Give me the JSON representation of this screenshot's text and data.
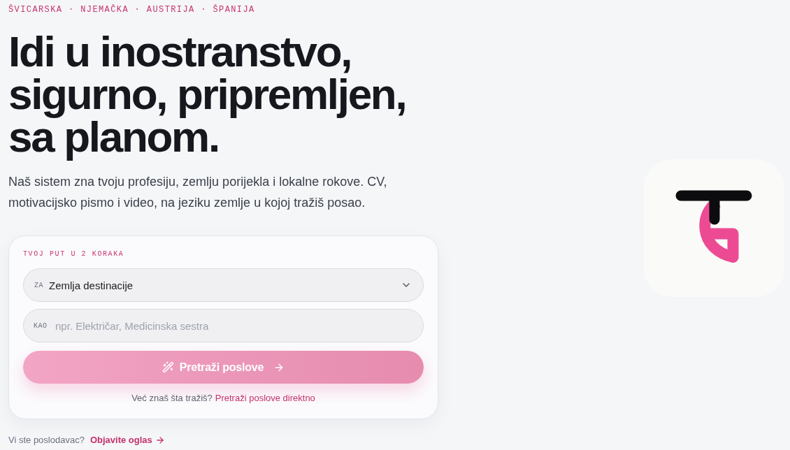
{
  "eyebrow": "ŠVICARSKA · NJEMAČKA · AUSTRIJA · ŠPANIJA",
  "headline_lines": [
    "Idi u inostranstvo,",
    "sigurno, pripremljen,",
    "sa planom."
  ],
  "description": "Naš sistem zna tvoju profesiju, zemlju porijekla i lokalne rokove. CV, motivacijsko pismo i video, na jeziku zemlje u kojoj tražiš posao.",
  "search_card": {
    "label": "TVOJ PUT U 2 KORAKA",
    "fields": [
      {
        "kind": "select",
        "prefix": "ZA",
        "value": "Zemlja destinacije"
      },
      {
        "kind": "text",
        "prefix": "KAO",
        "placeholder": "npr. Električar, Medicinska sestra"
      }
    ],
    "submit": {
      "label": "Pretraži poslove"
    },
    "hint": {
      "text": "Već znaš šta tražiš?",
      "link": "Pretraži poslove direktno"
    }
  },
  "employer": {
    "text": "Vi ste poslodavac?",
    "link": "Objavite oglas"
  }
}
